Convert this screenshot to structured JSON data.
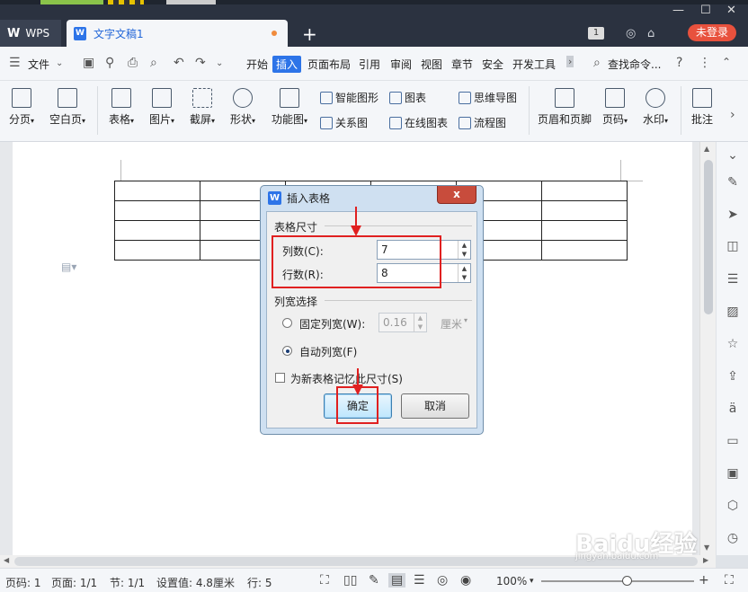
{
  "titlebar": {
    "app_tab": "WPS",
    "doc_tab": "文字文稿1",
    "badge": "1",
    "login": "未登录"
  },
  "menubar": {
    "file": "文件",
    "items": [
      "开始",
      "插入",
      "页面布局",
      "引用",
      "审阅",
      "视图",
      "章节",
      "安全",
      "开发工具"
    ],
    "active": "插入",
    "search": "查找命令..."
  },
  "ribbon": {
    "buttons": [
      "分页",
      "空白页",
      "表格",
      "图片",
      "截屏",
      "形状",
      "功能图",
      "页眉和页脚",
      "页码",
      "水印",
      "批注"
    ],
    "small": [
      "智能图形",
      "图表",
      "思维导图",
      "关系图",
      "在线图表",
      "流程图"
    ]
  },
  "dialog": {
    "title": "插入表格",
    "close": "x",
    "group_size": "表格尺寸",
    "cols_label": "列数(C):",
    "cols_value": "7",
    "rows_label": "行数(R):",
    "rows_value": "8",
    "group_width": "列宽选择",
    "fixed_label": "固定列宽(W):",
    "fixed_value": "0.16",
    "fixed_unit": "厘米",
    "auto_label": "自动列宽(F)",
    "remember_label": "为新表格记忆此尺寸(S)",
    "ok": "确定",
    "cancel": "取消"
  },
  "statusbar": {
    "page_no": "页码: 1",
    "page": "页面: 1/1",
    "section": "节: 1/1",
    "setting": "设置值: 4.8厘米",
    "row": "行: 5",
    "zoom": "100%"
  },
  "watermark": {
    "brand": "Baidu经验",
    "url": "jingyan.baidu.com"
  }
}
